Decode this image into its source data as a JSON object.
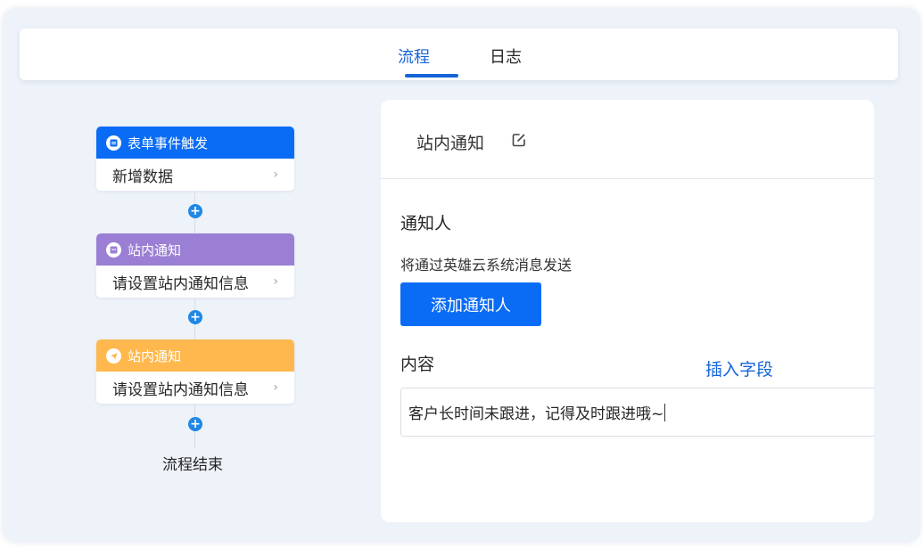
{
  "tabs": [
    {
      "label": "流程",
      "active": true
    },
    {
      "label": "日志",
      "active": false
    }
  ],
  "flow": {
    "nodes": [
      {
        "title": "表单事件触发",
        "body": "新增数据",
        "color": "#0a6cf5",
        "icon": "form-icon"
      },
      {
        "title": "站内通知",
        "body": "请设置站内通知信息",
        "color": "#9b7fd4",
        "icon": "message-icon"
      },
      {
        "title": "站内通知",
        "body": "请设置站内通知信息",
        "color": "#ffb84d",
        "icon": "send-icon"
      }
    ],
    "end_label": "流程结束"
  },
  "panel": {
    "title": "站内通知",
    "recipient_label": "通知人",
    "recipient_desc": "将通过英雄云系统消息发送",
    "add_button": "添加通知人",
    "content_label": "内容",
    "insert_field": "插入字段",
    "content_value": "客户长时间未跟进，记得及时跟进哦~"
  },
  "colors": {
    "accent": "#1565d8",
    "button": "#0a6cf5"
  }
}
